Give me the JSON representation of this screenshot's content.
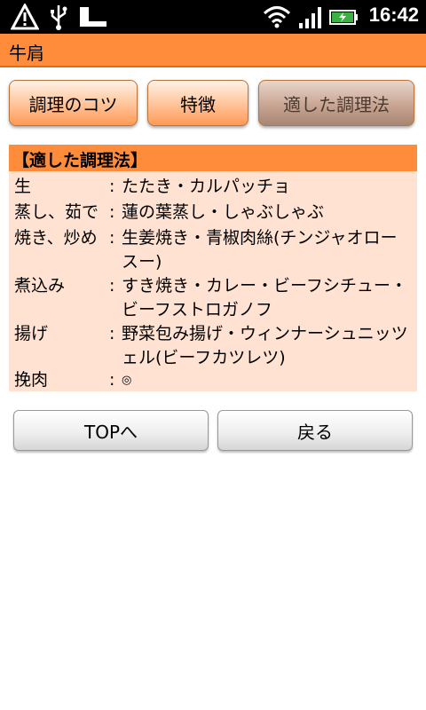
{
  "status_bar": {
    "time": "16:42",
    "icons": [
      "warning-icon",
      "usb-icon",
      "sd-card-icon",
      "wifi-icon",
      "signal-icon",
      "battery-charging-icon"
    ]
  },
  "title_bar": {
    "title": "牛肩"
  },
  "tabs": [
    {
      "label": "調理のコツ",
      "active": false
    },
    {
      "label": "特徴",
      "active": false
    },
    {
      "label": "適した調理法",
      "active": true
    }
  ],
  "section": {
    "header": "【適した調理法】",
    "rows": [
      {
        "label": "生",
        "colon": ":",
        "value": "たたき・カルパッチョ"
      },
      {
        "label": "蒸し、茹で",
        "colon": ":",
        "value": "蓮の葉蒸し・しゃぶしゃぶ"
      },
      {
        "label": "焼き、炒め",
        "colon": ":",
        "value": "生姜焼き・青椒肉絲(チンジャオロースー)"
      },
      {
        "label": "煮込み",
        "colon": ":",
        "value": "すき焼き・カレー・ビーフシチュー・ビーフストロガノフ"
      },
      {
        "label": "揚げ",
        "colon": ":",
        "value": "野菜包み揚げ・ウィンナーシュニッツェル(ビーフカツレツ)"
      },
      {
        "label": "挽肉",
        "colon": ":",
        "value": "◎"
      }
    ]
  },
  "buttons": {
    "top": "TOPへ",
    "back": "戻る"
  }
}
